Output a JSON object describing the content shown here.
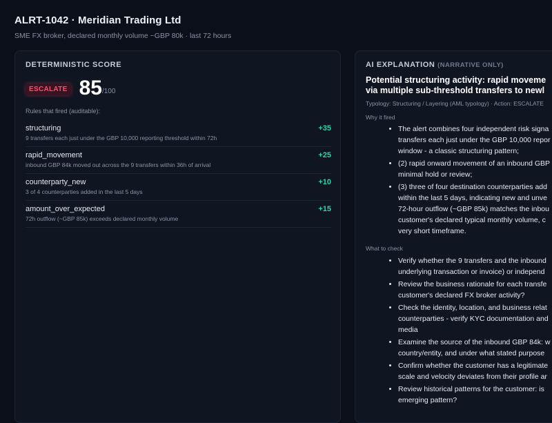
{
  "header": {
    "title": "ALRT-1042 · Meridian Trading Ltd",
    "subtitle": "SME FX broker, declared monthly volume ~GBP 80k · last 72 hours"
  },
  "score_panel": {
    "title": "DETERMINISTIC SCORE",
    "badge": "ESCALATE",
    "score": "85",
    "score_max": "/100",
    "rules_caption": "Rules that fired (auditable):",
    "rules": [
      {
        "name": "structuring",
        "desc": "9 transfers each just under the GBP 10,000 reporting threshold within 72h",
        "points": "+35"
      },
      {
        "name": "rapid_movement",
        "desc": "inbound GBP 84k moved out across the 9 transfers within 36h of arrival",
        "points": "+25"
      },
      {
        "name": "counterparty_new",
        "desc": "3 of 4 counterparties added in the last 5 days",
        "points": "+10"
      },
      {
        "name": "amount_over_expected",
        "desc": "72h outflow (~GBP 85k) exceeds declared monthly volume",
        "points": "+15"
      }
    ],
    "colors": {
      "escalate": "#ff4d6d",
      "points": "#2dd4aa"
    }
  },
  "ai_panel": {
    "title": "AI EXPLANATION",
    "title_note": "(NARRATIVE ONLY)",
    "heading_line1": "Potential structuring activity: rapid moveme",
    "heading_line2": "via multiple sub-threshold transfers to newl",
    "typology": "Typology: Structuring / Layering (AML typology) · Action: ESCALATE",
    "why_label": "Why it fired",
    "why_items": [
      [
        "The alert combines four independent risk signa",
        "transfers each just under the GBP 10,000 repor",
        "window - a classic structuring pattern;"
      ],
      [
        "(2) rapid onward movement of an inbound GBP",
        "minimal hold or review;"
      ],
      [
        "(3) three of four destination counterparties add",
        "within the last 5 days, indicating new and unve",
        "72-hour outflow (~GBP 85k) matches the inbou",
        "customer's declared typical monthly volume, c",
        "very short timeframe."
      ]
    ],
    "check_label": "What to check",
    "check_items": [
      [
        "Verify whether the 9 transfers and the inbound",
        "underlying transaction or invoice) or independ"
      ],
      [
        "Review the business rationale for each transfe",
        "customer's declared FX broker activity?"
      ],
      [
        "Check the identity, location, and business relat",
        "counterparties - verify KYC documentation and",
        "media"
      ],
      [
        "Examine the source of the inbound GBP 84k: w",
        "country/entity, and under what stated purpose"
      ],
      [
        "Confirm whether the customer has a legitimate",
        "scale and velocity deviates from their profile ar"
      ],
      [
        "Review historical patterns for the customer: is",
        "emerging pattern?"
      ]
    ]
  }
}
